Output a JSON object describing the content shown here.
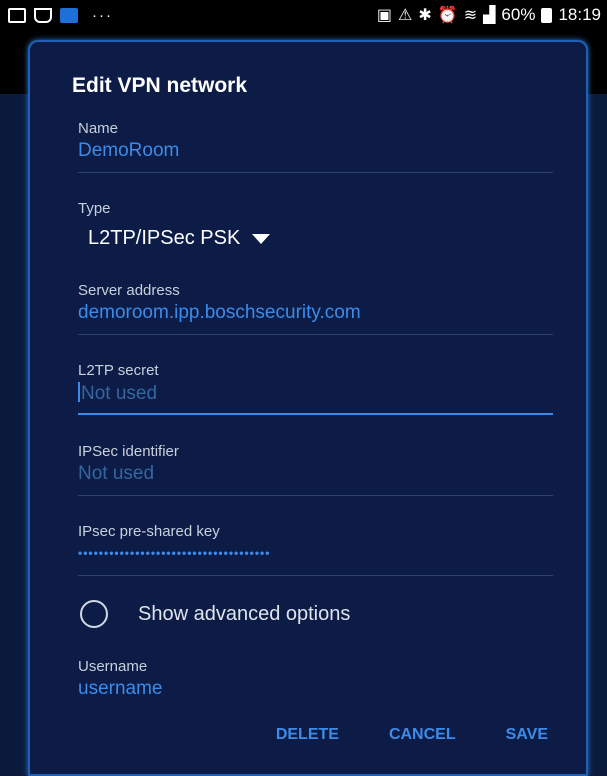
{
  "status_bar": {
    "dots": "···",
    "battery_percent": "60%",
    "time": "18:19",
    "icons": [
      "image-icon",
      "voicemail-icon",
      "app-icon",
      "photo-icon",
      "warning-icon",
      "bluetooth-icon",
      "alarm-icon",
      "wifi-icon",
      "signal-icon",
      "battery-icon"
    ]
  },
  "dialog": {
    "title": "Edit VPN network",
    "name": {
      "label": "Name",
      "value": "DemoRoom"
    },
    "type": {
      "label": "Type",
      "value": "L2TP/IPSec PSK"
    },
    "server": {
      "label": "Server address",
      "value": "demoroom.ipp.boschsecurity.com"
    },
    "l2tp_secret": {
      "label": "L2TP secret",
      "placeholder": "Not used"
    },
    "ipsec_id": {
      "label": "IPSec identifier",
      "placeholder": "Not used"
    },
    "psk": {
      "label": "IPsec pre-shared key",
      "value": "•••••••••••••••••••••••••••••••••••••"
    },
    "advanced": {
      "label": "Show advanced options",
      "checked": false
    },
    "username": {
      "label": "Username",
      "value": "username"
    },
    "buttons": {
      "delete": "DELETE",
      "cancel": "CANCEL",
      "save": "SAVE"
    }
  },
  "colors": {
    "accent": "#3d8be8",
    "background": "#0c1c46",
    "border": "#1f5fb5"
  }
}
